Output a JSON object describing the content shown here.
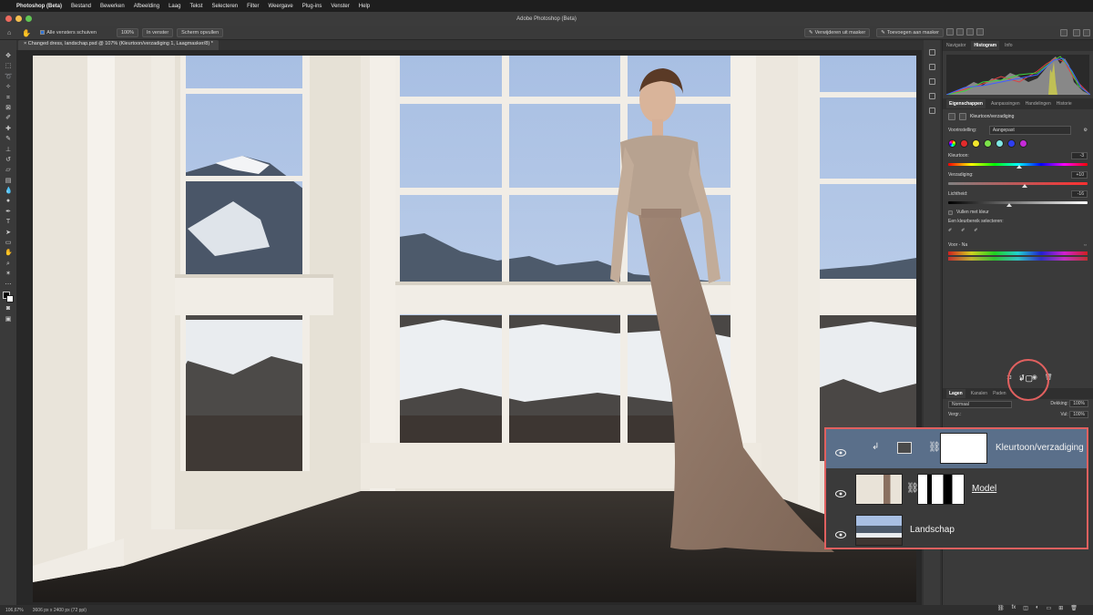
{
  "menubar": {
    "apple": "",
    "app_name": "Photoshop (Beta)",
    "items": [
      "Bestand",
      "Bewerken",
      "Afbeelding",
      "Laag",
      "Tekst",
      "Selecteren",
      "Filter",
      "Weergave",
      "Plug-ins",
      "Venster",
      "Help"
    ]
  },
  "window": {
    "title": "Adobe Photoshop (Beta)"
  },
  "options": {
    "scroll_all_label": "Alle vensters schuiven",
    "zoom_100": "100%",
    "fit_window": "In venster",
    "fill_screen": "Scherm opvullen",
    "remove_from_mask": "Verwijderen uit masker",
    "add_to_mask": "Toevoegen aan masker"
  },
  "document": {
    "tab_label": "Changed dress, landschap.psd @ 107% (Kleurtoon/verzadiging 1, Laagmasker/8) *"
  },
  "status": {
    "zoom": "106,67%",
    "doc_info": "3606 px x 2400 px (72 ppi)"
  },
  "panels": {
    "top_tabs": [
      "Navigator",
      "Histogram",
      "Info"
    ],
    "active_top_tab": "Histogram",
    "props_tabs": [
      "Eigenschappen",
      "Aanpassingen",
      "Handelingen",
      "Historie"
    ],
    "props_title": "Kleurtoon/verzadiging",
    "preset_label": "Voorinstelling:",
    "preset_value": "Aangepast",
    "hue_label": "Kleurtoon:",
    "hue_value": "-3",
    "sat_label": "Verzadiging:",
    "sat_value": "+10",
    "light_label": "Lichtheid:",
    "light_value": "-16",
    "colorize_label": "Vullen met kleur",
    "select_range_label": "Een kleurbereik selecteren:",
    "master_label": "Voor - Na",
    "layers_tabs": [
      "Lagen",
      "Kanalen",
      "Paden"
    ],
    "blend_mode": "Normaal",
    "opacity_label": "Dekking:",
    "opacity_value": "100%",
    "lock_label": "Vergr.:",
    "fill_label": "Vul:",
    "fill_value": "100%"
  },
  "layers": [
    {
      "name": "Kleurtoon/verzadiging",
      "selected": true
    },
    {
      "name": "Model",
      "selected": false
    },
    {
      "name": "Landschap",
      "selected": false
    }
  ],
  "colors": {
    "accent": "#2f73d4",
    "highlight": "#e0605f",
    "selected_layer": "#5a6f8a"
  }
}
